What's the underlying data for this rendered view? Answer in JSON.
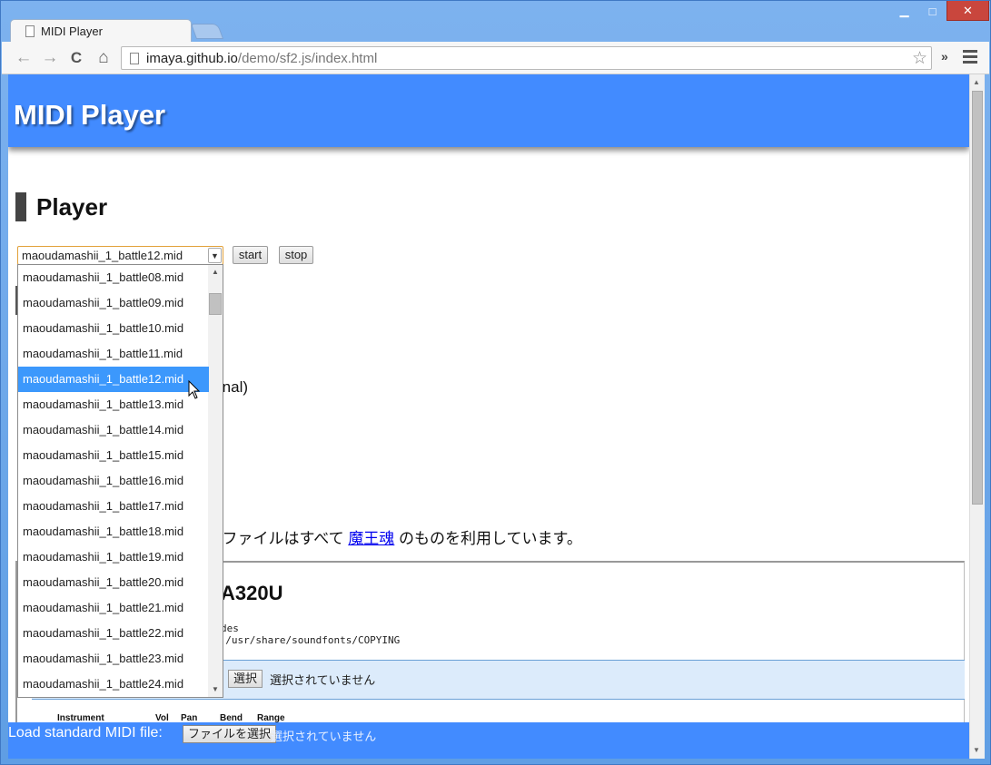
{
  "browser": {
    "tab_title": "MIDI Player",
    "url_host": "imaya.github.io",
    "url_path": "/demo/sf2.js/index.html",
    "window_controls": {
      "minimize": "▁",
      "maximize": "□",
      "close": "✕"
    },
    "nav_icons": {
      "back": "←",
      "forward": "→",
      "reload": "C",
      "home": "⌂"
    },
    "overflow_label": "»"
  },
  "page": {
    "site_title": "MIDI Player",
    "section_heading": "Player",
    "song_select": {
      "selected": "maoudamashii_1_battle12.mid",
      "options": [
        "maoudamashii_1_battle08.mid",
        "maoudamashii_1_battle09.mid",
        "maoudamashii_1_battle10.mid",
        "maoudamashii_1_battle11.mid",
        "maoudamashii_1_battle12.mid",
        "maoudamashii_1_battle13.mid",
        "maoudamashii_1_battle14.mid",
        "maoudamashii_1_battle15.mid",
        "maoudamashii_1_battle16.mid",
        "maoudamashii_1_battle17.mid",
        "maoudamashii_1_battle18.mid",
        "maoudamashii_1_battle19.mid",
        "maoudamashii_1_battle20.mid",
        "maoudamashii_1_battle21.mid",
        "maoudamashii_1_battle22.mid",
        "maoudamashii_1_battle23.mid",
        "maoudamashii_1_battle24.mid"
      ]
    },
    "start_label": "start",
    "stop_label": "stop",
    "partial_text_1": "rnal)",
    "attribution_prefix": "I ファイルはすべて",
    "attribution_link": "魔王魂",
    "attribution_suffix": "のものを利用しています。",
    "panel": {
      "title": "A320U",
      "mono_line_1": "des",
      "mono_line_2": "e /usr/share/soundfonts/COPYING",
      "file_button": "選択",
      "file_status": "選択されていません",
      "columns": [
        "Instrument",
        "Vol",
        "Pan",
        "Bend",
        "Range"
      ]
    },
    "footer": {
      "label": "Load standard MIDI file:",
      "file_button": "ファイルを選択",
      "file_status": "選択されていません"
    }
  }
}
